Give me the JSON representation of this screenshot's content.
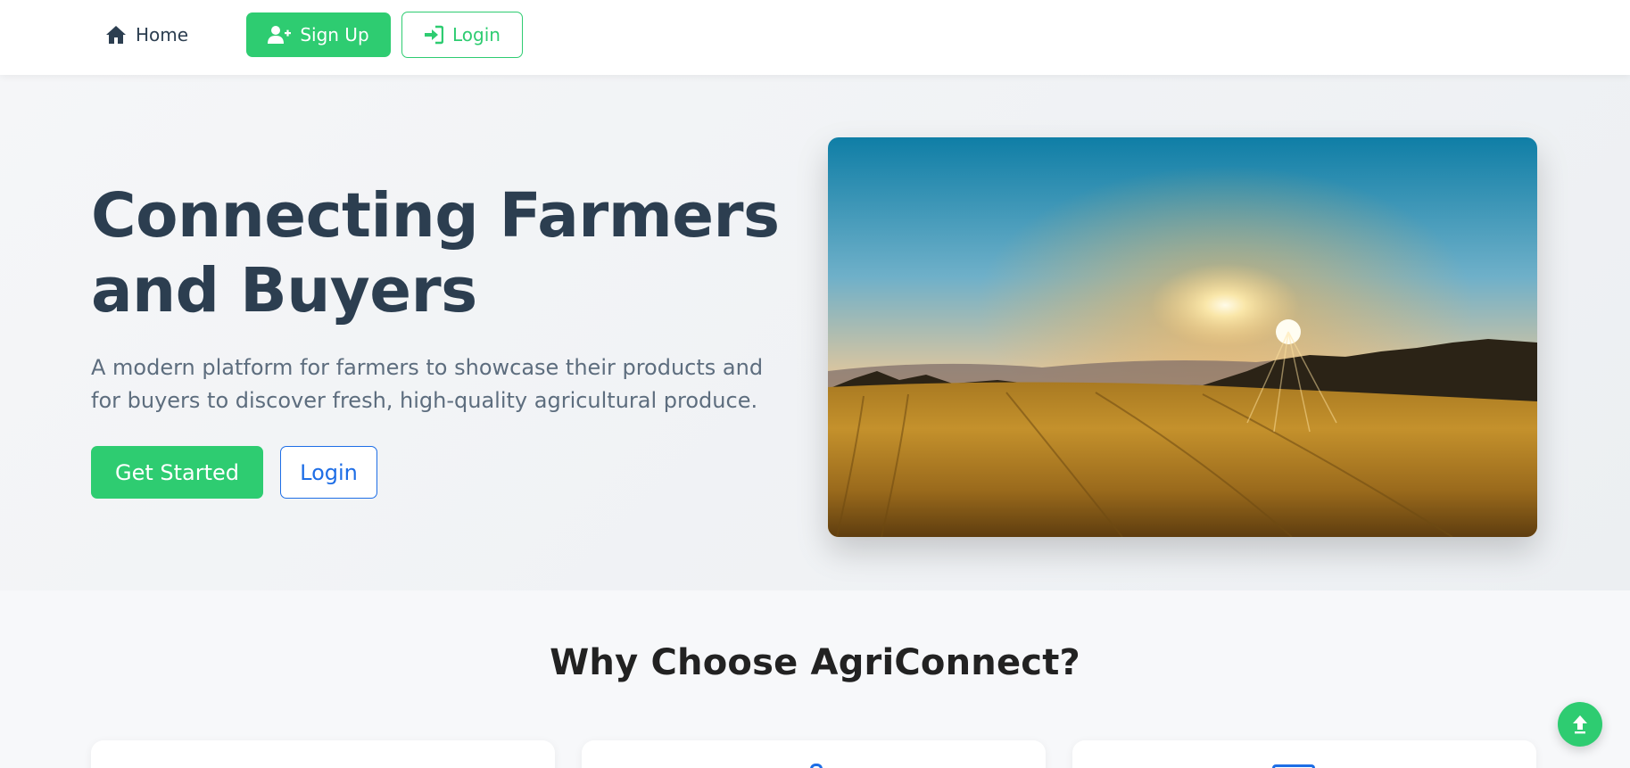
{
  "nav": {
    "home_label": "Home",
    "signup_label": "Sign Up",
    "login_label": "Login"
  },
  "hero": {
    "title_line1": "Connecting Farmers",
    "title_line2": "and Buyers",
    "subtitle_line1": "A modern platform for farmers to showcase their products and",
    "subtitle_line2": "for buyers to discover fresh, high-quality agricultural produce.",
    "cta_primary": "Get Started",
    "cta_secondary": "Login",
    "image_subject": "sunset over golden wheat field"
  },
  "features": {
    "title": "Why Choose AgriConnect?"
  },
  "icons": {
    "home": "home-icon",
    "signup": "user-plus-icon",
    "login": "sign-in-icon",
    "scroll_top": "arrow-up-icon"
  },
  "colors": {
    "primary_green": "#2ecc71",
    "accent_blue": "#1e6ee6",
    "heading": "#2c3e50",
    "body_text": "#5d6d7e"
  }
}
